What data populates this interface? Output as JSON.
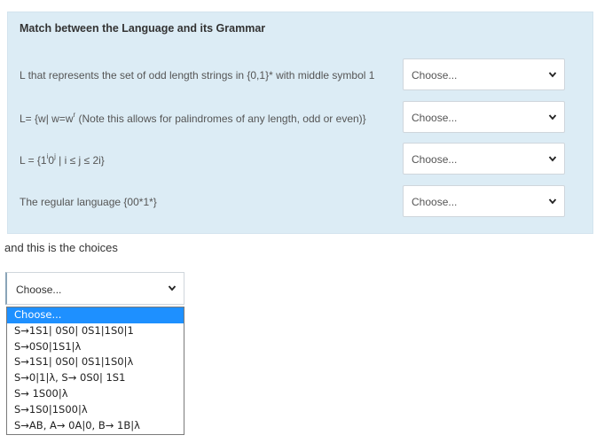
{
  "panel": {
    "title": "Match between the Language and its Grammar",
    "rows": [
      {
        "text": "L that represents the set of odd length strings in {0,1}* with middle symbol 1",
        "select": "Choose..."
      },
      {
        "text_a": "L= {w| w=w",
        "text_sup": "r",
        "text_b": " (Note this allows for palindromes of any length, odd or even)}",
        "select": "Choose..."
      },
      {
        "text_a": "L = {1",
        "text_sup1": "i",
        "text_mid": "0",
        "text_sup2": "j",
        "text_b": " | i ≤ j ≤ 2i}",
        "select": "Choose..."
      },
      {
        "text": "The regular language {00*1*}",
        "select": "Choose..."
      }
    ]
  },
  "caption": "and this is the choices",
  "dropdown": {
    "value": "Choose...",
    "options": [
      "Choose...",
      "S→1S1| 0S0| 0S1|1S0|1",
      "S→0S0|1S1|λ",
      "S→1S1| 0S0| 0S1|1S0|λ",
      "S→0|1|λ, S→ 0S0| 1S1",
      "S→ 1S00|λ",
      "S→1S0|1S00|λ",
      "S→AB, A→ 0A|0, B→ 1B|λ"
    ],
    "selected_index": 0
  }
}
